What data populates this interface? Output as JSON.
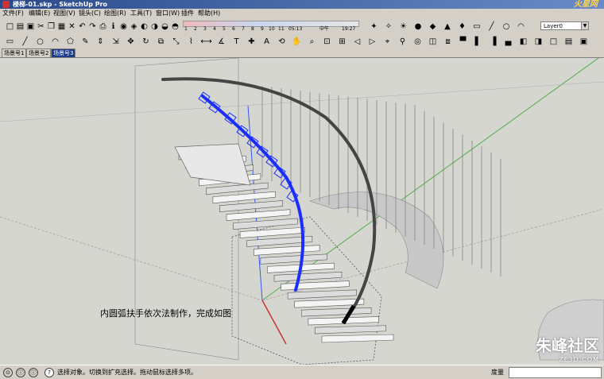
{
  "window": {
    "title": "楼梯-01.skp - SketchUp Pro",
    "brand": "火星网"
  },
  "menu": [
    "文件(F)",
    "编辑(E)",
    "视图(V)",
    "镜头(C)",
    "绘图(R)",
    "工具(T)",
    "窗口(W)",
    "插件",
    "帮助(H)"
  ],
  "shadow_bar": {
    "hours": [
      "1",
      "2",
      "3",
      "4",
      "5",
      "6",
      "7",
      "8",
      "9",
      "10",
      "11"
    ],
    "time": "05:13",
    "noon": "中午",
    "end_time": "19:27"
  },
  "layer": {
    "current": "Layer0"
  },
  "toolbar1_icons": [
    "new-icon",
    "open-icon",
    "save-icon",
    "cut-icon",
    "copy-icon",
    "paste-icon",
    "erase-icon",
    "undo-icon",
    "redo-icon",
    "print-icon",
    "model-info-icon",
    "camera-icon",
    "camera-icon-2",
    "camera-icon-3",
    "camera-icon-4",
    "shadow-icon",
    "fog-icon"
  ],
  "toolbar1_right_icons": [
    "sandbox-icon",
    "photo-icon",
    "ruby-icon",
    "report-icon",
    "tag-icon",
    "sphere-icon",
    "star-icon",
    "sun-icon",
    "sphere-icon-2",
    "layer-icon",
    "house-icon"
  ],
  "toolbar2_icons": [
    "select-icon",
    "component-icon",
    "paint-icon",
    "eraser-icon",
    "rectangle-icon",
    "line-icon",
    "circle-icon",
    "arc-icon",
    "polygon-icon",
    "freehand-icon",
    "push-pull-icon",
    "follow-me-icon",
    "move-icon",
    "rotate-icon",
    "offset-icon",
    "scale-icon",
    "tape-icon",
    "dimension-icon",
    "protractor-icon",
    "text-icon",
    "axes-icon",
    "3d-text-icon",
    "orbit-icon",
    "pan-icon",
    "zoom-icon",
    "zoom-window-icon",
    "zoom-extents-icon",
    "previous-icon",
    "next-icon",
    "position-camera-icon",
    "walk-icon",
    "look-around-icon",
    "section-icon",
    "iso-icon",
    "top-icon",
    "front-icon",
    "right-icon",
    "back-icon",
    "left-icon"
  ],
  "scene_tabs": [
    "场景号1",
    "场景号2",
    "场景号3"
  ],
  "active_tab": 2,
  "caption": "内圆弧扶手依次法制作，完成如图",
  "watermark": {
    "main": "朱峰社区",
    "sub": "ZF3D.COM"
  },
  "status": {
    "text": "选择对象。切换到扩充选择。拖动鼠标选择多项。",
    "measure_label": "度量"
  }
}
